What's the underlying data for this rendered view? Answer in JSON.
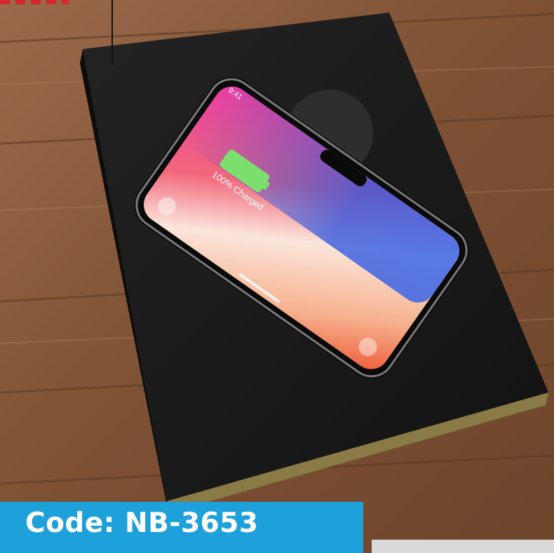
{
  "product": {
    "code_label": "Code: NB-3653"
  },
  "phone_screen": {
    "status_time": "9:41",
    "charge_text": "100% Charged"
  },
  "colors": {
    "banner_blue": "#1ea1db",
    "wood": "#8a5a3c",
    "notebook": "#1b1b1b",
    "battery_green": "#7bde6e"
  }
}
